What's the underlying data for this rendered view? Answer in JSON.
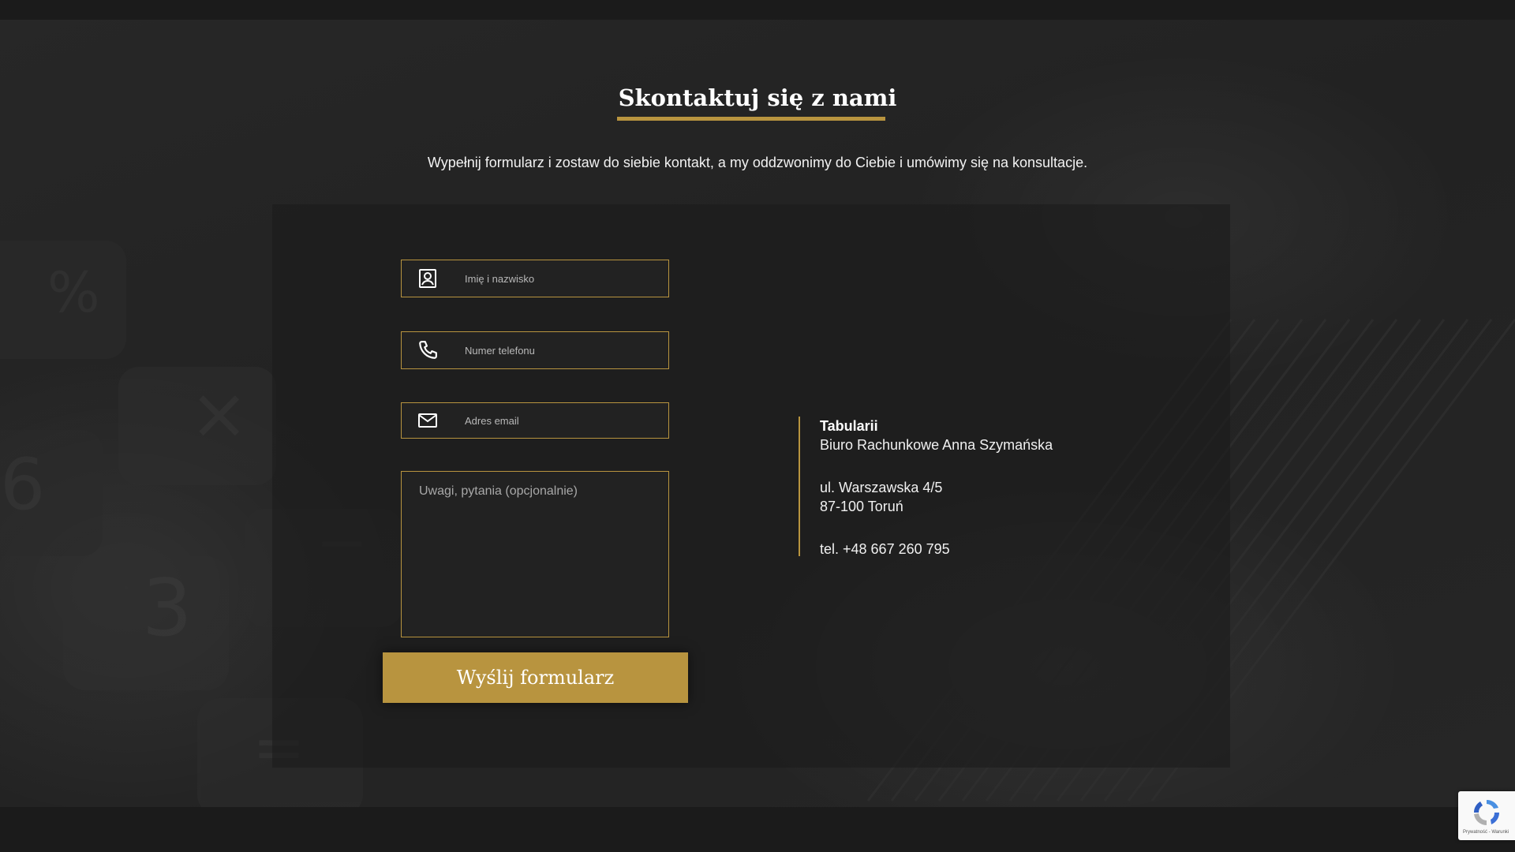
{
  "section": {
    "title": "Skontaktuj się z nami",
    "subtitle": "Wypełnij formularz i zostaw do siebie kontakt, a my oddzwonimy do Ciebie i umówimy się na konsultacje."
  },
  "form": {
    "name": {
      "placeholder": "Imię i nazwisko",
      "value": "",
      "icon": "person-card-icon"
    },
    "phone": {
      "placeholder": "Numer telefonu",
      "value": "",
      "icon": "phone-icon"
    },
    "email": {
      "placeholder": "Adres email",
      "value": "",
      "icon": "envelope-icon"
    },
    "notes": {
      "placeholder": "Uwagi, pytania (opcjonalnie)",
      "value": ""
    },
    "submit_label": "Wyślij formularz"
  },
  "contact": {
    "company": "Tabularii",
    "office": "Biuro Rachunkowe Anna Szymańska",
    "street": "ul. Warszawska 4/5",
    "city": "87-100 Toruń",
    "phone": "tel. +48 667 260 795"
  },
  "recaptcha": {
    "terms": "Prywatność - Warunki",
    "icon": "recaptcha-logo-icon"
  },
  "colors": {
    "accent": "#b8943f",
    "background": "#1c1c1c",
    "field_background": "#222222"
  }
}
